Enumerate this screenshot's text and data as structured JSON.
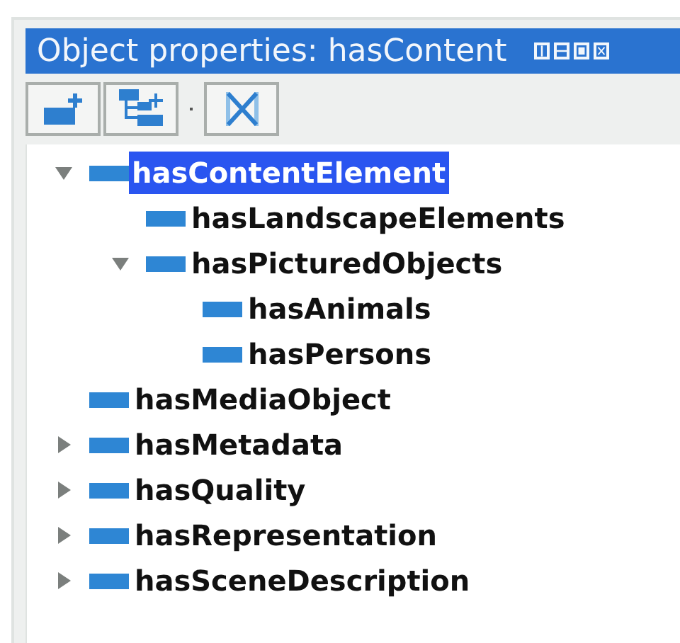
{
  "window": {
    "title": "Object properties: hasContent"
  },
  "tree": [
    {
      "label": "hasContentElement",
      "kind": "branch",
      "expanded": true,
      "selected": true,
      "children": [
        {
          "label": "hasLandscapeElements",
          "kind": "leaf",
          "selected": false
        },
        {
          "label": "hasPicturedObjects",
          "kind": "branch",
          "expanded": true,
          "selected": false,
          "children": [
            {
              "label": "hasAnimals",
              "kind": "leaf",
              "selected": false
            },
            {
              "label": "hasPersons",
              "kind": "leaf",
              "selected": false
            }
          ]
        }
      ]
    },
    {
      "label": "hasMediaObject",
      "kind": "leaf",
      "selected": false
    },
    {
      "label": "hasMetadata",
      "kind": "branch",
      "expanded": false,
      "selected": false
    },
    {
      "label": "hasQuality",
      "kind": "branch",
      "expanded": false,
      "selected": false
    },
    {
      "label": "hasRepresentation",
      "kind": "branch",
      "expanded": false,
      "selected": false
    },
    {
      "label": "hasSceneDescription",
      "kind": "branch",
      "expanded": false,
      "selected": false
    }
  ]
}
